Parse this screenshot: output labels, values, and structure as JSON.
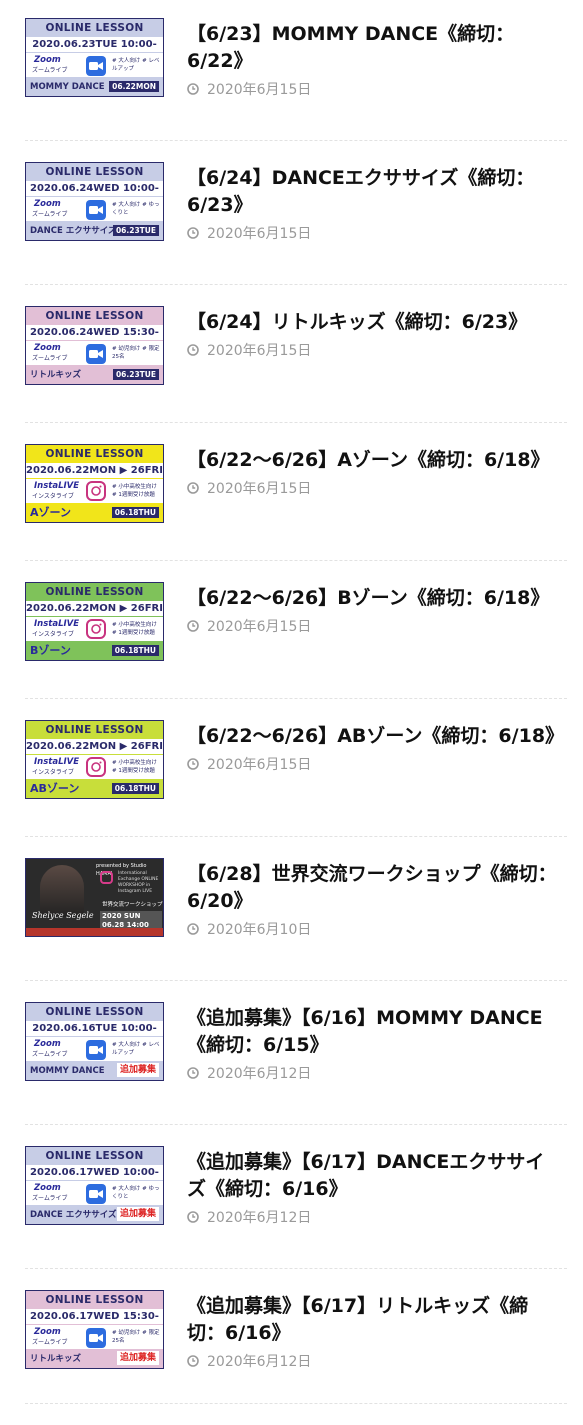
{
  "posts": [
    {
      "title": "【6/23】MOMMY DANCE《締切：6/22》",
      "date": "2020年6月15日",
      "thumb": {
        "kind": "zoom",
        "head": "ONLINE LESSON",
        "date": "2020.06.23TUE 10:00-",
        "app": "Zoom",
        "app_sub": "ズームライブ",
        "notes": "# 大人向け # レベルアップ",
        "footer": "MOMMY DANCE",
        "deadline": "06.22MON",
        "bg": "#c7cde6",
        "foot_bg": "#c7cde6",
        "accent": "#2a2a6a"
      }
    },
    {
      "title": "【6/24】DANCEエクササイズ《締切：6/23》",
      "date": "2020年6月15日",
      "thumb": {
        "kind": "zoom",
        "head": "ONLINE LESSON",
        "date": "2020.06.24WED 10:00-",
        "app": "Zoom",
        "app_sub": "ズームライブ",
        "notes": "# 大人向け # ゆっくりと",
        "footer": "DANCE エクササイズ",
        "deadline": "06.23TUE",
        "bg": "#c7cde6",
        "foot_bg": "#c7cde6",
        "accent": "#2a2a6a"
      }
    },
    {
      "title": "【6/24】リトルキッズ《締切：6/23》",
      "date": "2020年6月15日",
      "thumb": {
        "kind": "zoom",
        "head": "ONLINE LESSON",
        "date": "2020.06.24WED 15:30-",
        "app": "Zoom",
        "app_sub": "ズームライブ",
        "notes": "# 幼児向け # 限定 25名",
        "footer": "リトルキッズ",
        "deadline": "06.23TUE",
        "bg": "#e2bfd6",
        "foot_bg": "#e2bfd6",
        "accent": "#2a2a6a"
      }
    },
    {
      "title": "【6/22〜6/26】Aゾーン《締切：6/18》",
      "date": "2020年6月15日",
      "thumb": {
        "kind": "insta",
        "head": "ONLINE LESSON",
        "date": "2020.06.22MON ▶ 26FRI",
        "app": "InstaLIVE",
        "app_sub": "インスタライブ",
        "notes": "# 小中高校生向け # 1週間受け放題",
        "footer": "Aゾーン",
        "deadline": "06.18THU",
        "bg": "#f1e51a",
        "foot_bg": "#f1e51a",
        "accent": "#2a2a6a"
      }
    },
    {
      "title": "【6/22〜6/26】Bゾーン《締切：6/18》",
      "date": "2020年6月15日",
      "thumb": {
        "kind": "insta",
        "head": "ONLINE LESSON",
        "date": "2020.06.22MON ▶ 26FRI",
        "app": "InstaLIVE",
        "app_sub": "インスタライブ",
        "notes": "# 小中高校生向け # 1週間受け放題",
        "footer": "Bゾーン",
        "deadline": "06.18THU",
        "bg": "#7fc25a",
        "foot_bg": "#7fc25a",
        "accent": "#2a2a6a"
      }
    },
    {
      "title": "【6/22〜6/26】ABゾーン《締切：6/18》",
      "date": "2020年6月15日",
      "thumb": {
        "kind": "insta",
        "head": "ONLINE LESSON",
        "date": "2020.06.22MON ▶ 26FRI",
        "app": "InstaLIVE",
        "app_sub": "インスタライブ",
        "notes": "# 小中高校生向け # 1週間受け放題",
        "footer": "ABゾーン",
        "deadline": "06.18THU",
        "bg": "#c8de3a",
        "foot_bg": "#c8de3a",
        "accent": "#2a2a6a"
      }
    },
    {
      "title": "【6/28】世界交流ワークショップ《締切：6/20》",
      "date": "2020年6月10日",
      "thumb": {
        "kind": "photo",
        "head": "presented by Studio HAMAI",
        "date": "2020 SUN 06.28 14:00",
        "app": "",
        "app_sub": "世界交流ワークショップ",
        "notes": "International Exchange ONLINE WORKSHOP in Instagram LIVE",
        "footer": "Shelyce Segele",
        "deadline": "",
        "bg": "#3a3a3a",
        "foot_bg": "#b5352b",
        "accent": "#b5352b"
      }
    },
    {
      "title": "《追加募集》【6/16】MOMMY DANCE《締切：6/15》",
      "date": "2020年6月12日",
      "thumb": {
        "kind": "zoom",
        "head": "ONLINE LESSON",
        "date": "2020.06.16TUE 10:00-",
        "app": "Zoom",
        "app_sub": "ズームライブ",
        "notes": "# 大人向け # レベルアップ",
        "footer": "MOMMY DANCE",
        "deadline": "追加募集",
        "bg": "#c7cde6",
        "foot_bg": "#c7cde6",
        "accent": "#2a2a6a"
      }
    },
    {
      "title": "《追加募集》【6/17】DANCEエクササイズ《締切：6/16》",
      "date": "2020年6月12日",
      "thumb": {
        "kind": "zoom",
        "head": "ONLINE LESSON",
        "date": "2020.06.17WED 10:00-",
        "app": "Zoom",
        "app_sub": "ズームライブ",
        "notes": "# 大人向け # ゆっくりと",
        "footer": "DANCE エクササイズ",
        "deadline": "追加募集",
        "bg": "#c7cde6",
        "foot_bg": "#c7cde6",
        "accent": "#2a2a6a"
      }
    },
    {
      "title": "《追加募集》【6/17】リトルキッズ《締切：6/16》",
      "date": "2020年6月12日",
      "thumb": {
        "kind": "zoom",
        "head": "ONLINE LESSON",
        "date": "2020.06.17WED 15:30-",
        "app": "Zoom",
        "app_sub": "ズームライブ",
        "notes": "# 幼児向け # 限定 25名",
        "footer": "リトルキッズ",
        "deadline": "追加募集",
        "bg": "#e2bfd6",
        "foot_bg": "#e2bfd6",
        "accent": "#2a2a6a"
      }
    }
  ],
  "icons": {
    "date": "clock-icon",
    "zoom": "video-camera-icon",
    "insta": "instagram-icon"
  }
}
